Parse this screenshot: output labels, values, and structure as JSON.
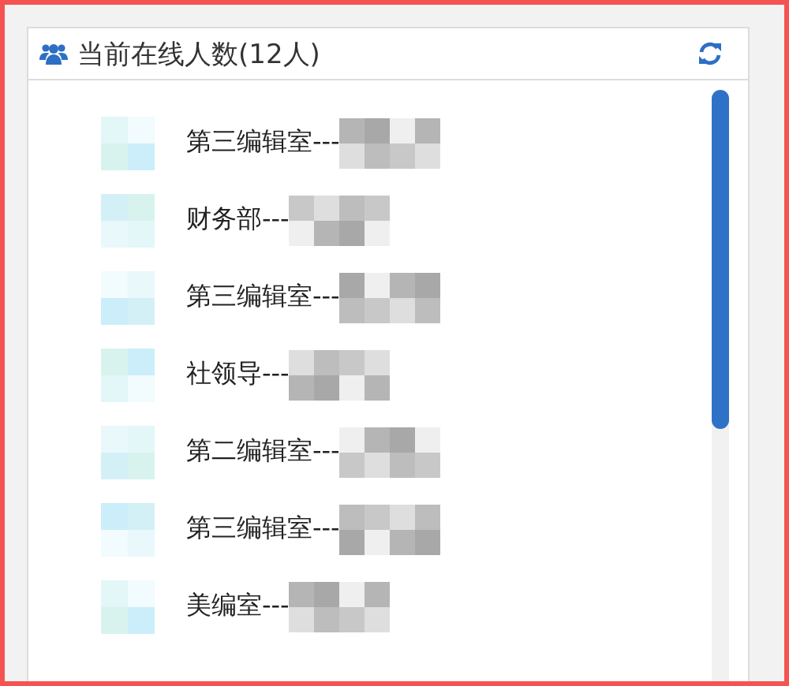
{
  "panel": {
    "title": "当前在线人数(12人)"
  },
  "users": [
    {
      "name": "第三编辑室---"
    },
    {
      "name": "财务部---"
    },
    {
      "name": "第三编辑室---"
    },
    {
      "name": "社领导---"
    },
    {
      "name": "第二编辑室---"
    },
    {
      "name": "第三编辑室---"
    },
    {
      "name": "美编室---"
    }
  ]
}
